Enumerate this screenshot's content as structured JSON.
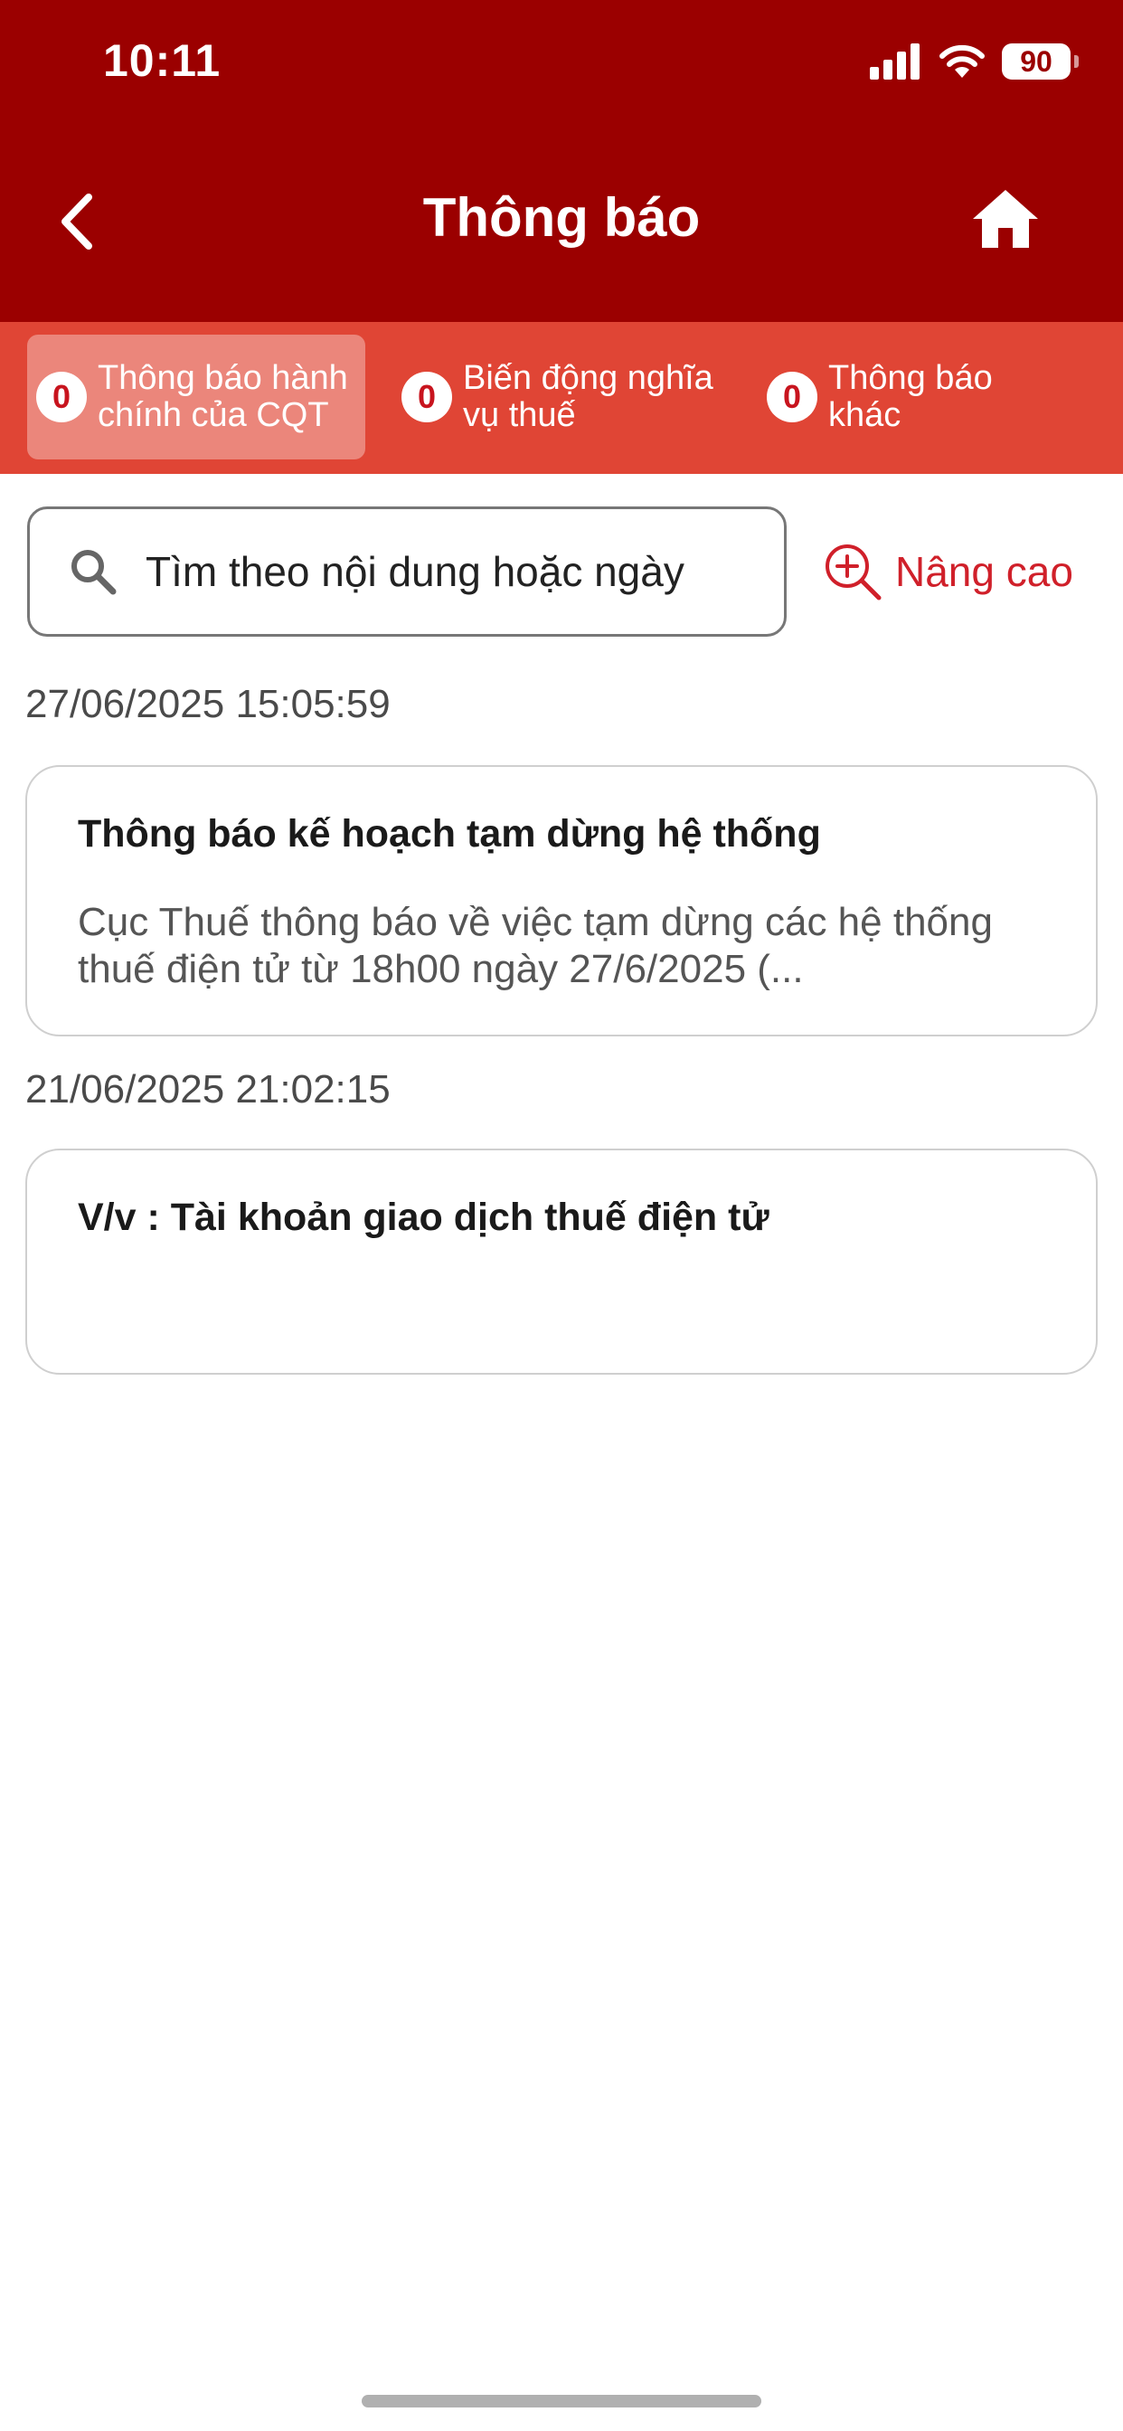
{
  "status_bar": {
    "time": "10:11",
    "battery": "90",
    "icons": [
      "signal-icon",
      "wifi-icon",
      "battery-icon"
    ]
  },
  "header": {
    "title": "Thông báo",
    "back_icon": "chevron-left-icon",
    "home_icon": "home-icon"
  },
  "tabs": [
    {
      "label": "Thông báo hành chính của CQT",
      "count": "0",
      "active": true
    },
    {
      "label": "Biến động nghĩa vụ thuế",
      "count": "0",
      "active": false
    },
    {
      "label": "Thông báo khác",
      "count": "0",
      "active": false
    }
  ],
  "search": {
    "placeholder": "Tìm theo nội dung hoặc ngày",
    "value": "",
    "icon": "search-icon"
  },
  "advanced": {
    "label": "Nâng cao",
    "icon": "zoom-in-icon"
  },
  "notifications": [
    {
      "date": "27/06/2025 15:05:59",
      "title": "Thông báo kế hoạch tạm dừng hệ thống",
      "body": "Cục Thuế thông báo về việc tạm dừng các hệ thống thuế điện tử từ 18h00 ngày 27/6/2025 (..."
    },
    {
      "date": "21/06/2025 21:02:15",
      "title": "V/v : Tài khoản giao dịch thuế điện tử",
      "body": ""
    }
  ],
  "colors": {
    "header": "#9b0000",
    "tab_bar": "#e04535",
    "accent": "#d0202a"
  }
}
